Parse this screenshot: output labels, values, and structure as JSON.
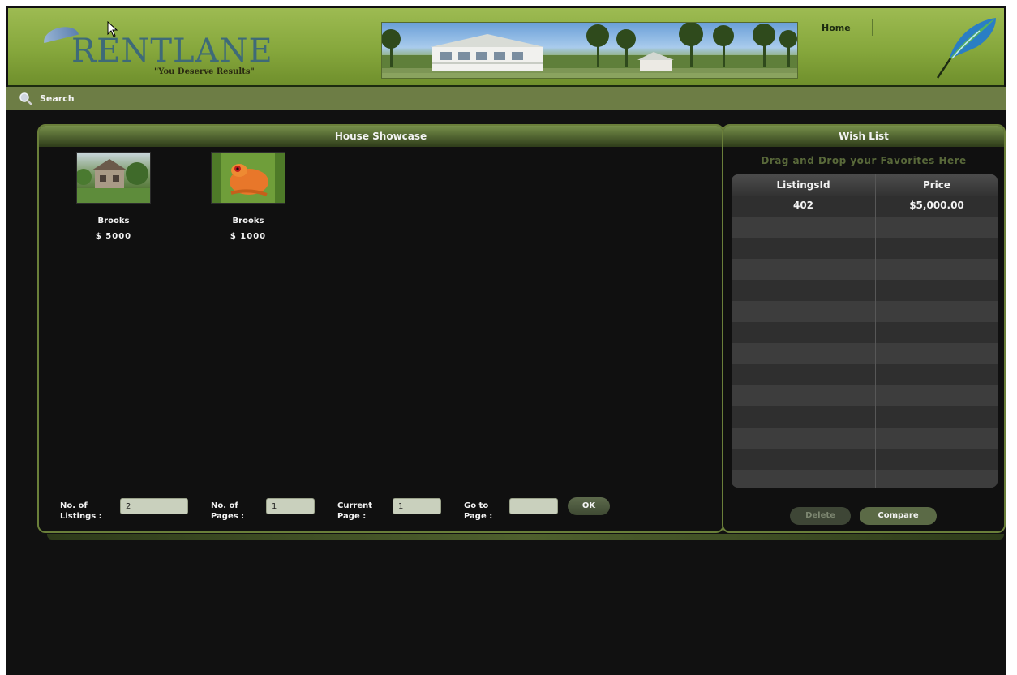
{
  "brand": {
    "name": "RENTLANE",
    "tagline": "\"You Deserve Results\""
  },
  "nav": {
    "home_label": "Home"
  },
  "search": {
    "label": "Search",
    "icon": "magnifier-icon"
  },
  "showcase": {
    "title": "House Showcase",
    "items": [
      {
        "name": "Brooks",
        "price": "$ 5000",
        "image": "house-photo"
      },
      {
        "name": "Brooks",
        "price": "$ 1000",
        "image": "frog-photo"
      }
    ],
    "pagination": {
      "listings_label": "No. of\nListings :",
      "listings_value": "2",
      "pages_label": "No. of\nPages :",
      "pages_value": "1",
      "current_label": "Current\nPage :",
      "current_value": "1",
      "goto_label": "Go to\nPage :",
      "goto_value": "",
      "ok_label": "OK"
    }
  },
  "wishlist": {
    "title": "Wish List",
    "subtitle": "Drag and Drop your Favorites Here",
    "columns": [
      "ListingsId",
      "Price"
    ],
    "rows": [
      {
        "id": "402",
        "price": "$5,000.00"
      }
    ],
    "delete_label": "Delete",
    "compare_label": "Compare"
  },
  "colors": {
    "header_green": "#86a73c",
    "search_bar": "#6d7d45",
    "panel_border": "#6a7f3a",
    "background": "#111111"
  }
}
